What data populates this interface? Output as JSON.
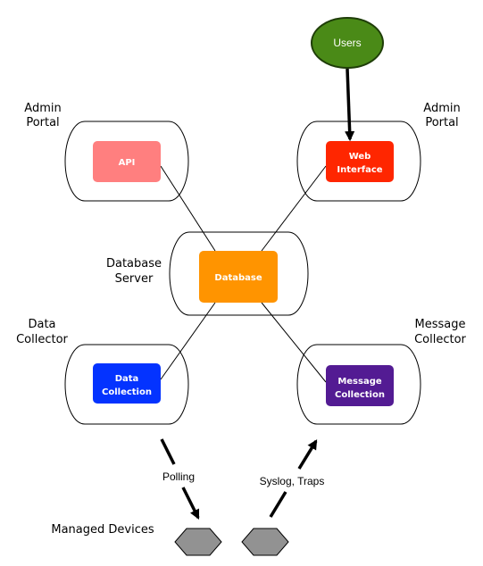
{
  "users": {
    "label": "Users",
    "color": "#4a8a17"
  },
  "groups": [
    {
      "id": "admin-portal-left",
      "label_lines": [
        "Admin",
        "Portal"
      ]
    },
    {
      "id": "admin-portal-right",
      "label_lines": [
        "Admin",
        "Portal"
      ]
    },
    {
      "id": "database-server",
      "label_lines": [
        "Database",
        "Server"
      ]
    },
    {
      "id": "data-collector",
      "label_lines": [
        "Data",
        "Collector"
      ]
    },
    {
      "id": "message-collector",
      "label_lines": [
        "Message",
        "Collector"
      ]
    }
  ],
  "components": [
    {
      "id": "api",
      "lines": [
        "API"
      ],
      "color": "#ff7f7f"
    },
    {
      "id": "web-interface",
      "lines": [
        "Web",
        "Interface"
      ],
      "color": "#ff2600"
    },
    {
      "id": "database",
      "lines": [
        "Database"
      ],
      "color": "#ff9400"
    },
    {
      "id": "data-collection",
      "lines": [
        "Data",
        "Collection"
      ],
      "color": "#0433ff"
    },
    {
      "id": "message-collection",
      "lines": [
        "Message",
        "Collection"
      ],
      "color": "#531b93"
    }
  ],
  "edges": {
    "polling": "Polling",
    "syslog": "Syslog, Traps"
  },
  "managed_devices": {
    "label": "Managed Devices",
    "color": "#929292"
  }
}
